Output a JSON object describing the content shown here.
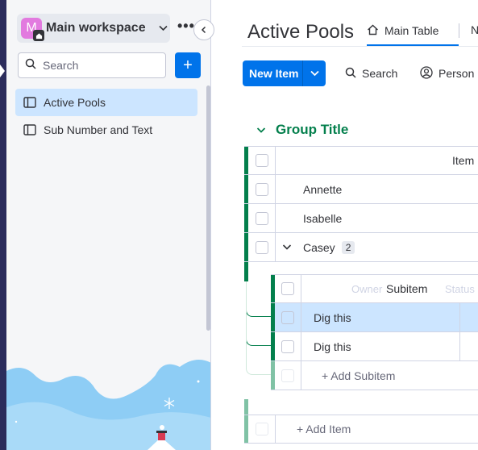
{
  "workspace": {
    "initial": "M",
    "name": "Main workspace",
    "more": "•••"
  },
  "sidebar": {
    "search_placeholder": "Search",
    "add_label": "+",
    "items": [
      {
        "label": "Active Pools",
        "active": true
      },
      {
        "label": "Sub Number and Text",
        "active": false
      }
    ]
  },
  "board": {
    "title": "Active Pools",
    "tabs": [
      {
        "label": "Main Table"
      },
      {
        "label": "N"
      }
    ]
  },
  "toolbar": {
    "new_item": "New Item",
    "search": "Search",
    "person": "Person"
  },
  "group": {
    "title": "Group Title",
    "color": "#037f4c",
    "column_header": "Item",
    "items": [
      {
        "name": "Annette"
      },
      {
        "name": "Isabelle"
      },
      {
        "name": "Casey",
        "subitem_count": "2"
      }
    ],
    "add_item": "+ Add Item"
  },
  "subitems": {
    "column_header": "Subitem",
    "ghost_left": "Owner",
    "ghost_right": "Status",
    "items": [
      {
        "name": "Dig this",
        "selected": true
      },
      {
        "name": "Dig this",
        "selected": false
      }
    ],
    "add_subitem": "+ Add Subitem"
  },
  "colors": {
    "accent": "#0073ea",
    "sidebar_bg": "#f5f6f8",
    "selected_bg": "#cce5ff",
    "group_green": "#037f4c"
  }
}
